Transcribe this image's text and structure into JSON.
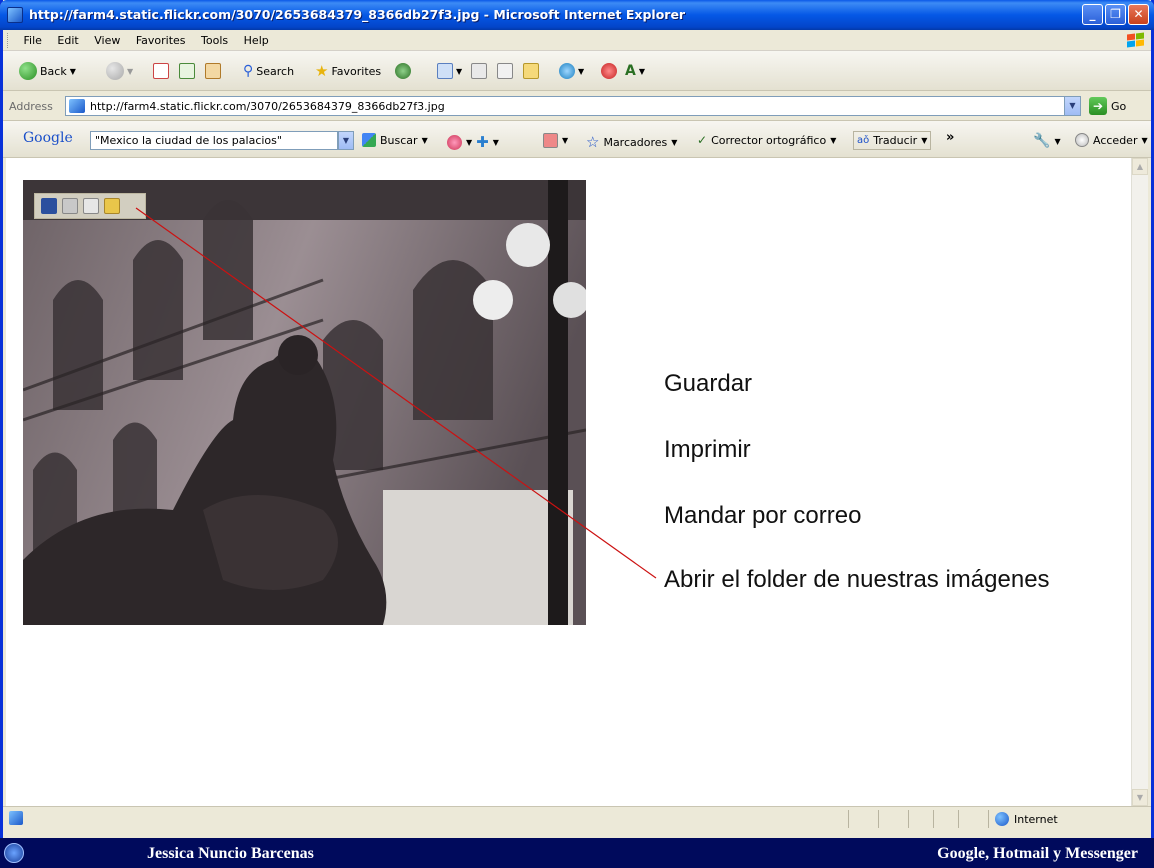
{
  "window": {
    "title": "http://farm4.static.flickr.com/3070/2653684379_8366db27f3.jpg - Microsoft Internet Explorer"
  },
  "menu": [
    "File",
    "Edit",
    "View",
    "Favorites",
    "Tools",
    "Help"
  ],
  "toolbar": {
    "back_label": "Back",
    "search_label": "Search",
    "favorites_label": "Favorites"
  },
  "address": {
    "label": "Address",
    "url": "http://farm4.static.flickr.com/3070/2653684379_8366db27f3.jpg",
    "go_label": "Go"
  },
  "google_toolbar": {
    "logo": "Google",
    "search_value": "\"Mexico la ciudad de los palacios\"",
    "buscar_label": "Buscar",
    "marcadores_label": "Marcadores",
    "corrector_label": "Corrector ortográfico",
    "traducir_label": "Traducir",
    "acceder_label": "Acceder"
  },
  "annotations": {
    "guardar": "Guardar",
    "imprimir": "Imprimir",
    "mandar": "Mandar por correo",
    "abrir": "Abrir el folder de nuestras imágenes"
  },
  "status": {
    "zone": "Internet"
  },
  "taskbar": {
    "left_text": "Jessica Nuncio Barcenas",
    "right_text": "Google, Hotmail y Messenger"
  },
  "colors": {
    "title_blue": "#0558e6",
    "annotation_line": "#cc1111",
    "taskbar": "#000a5c"
  }
}
